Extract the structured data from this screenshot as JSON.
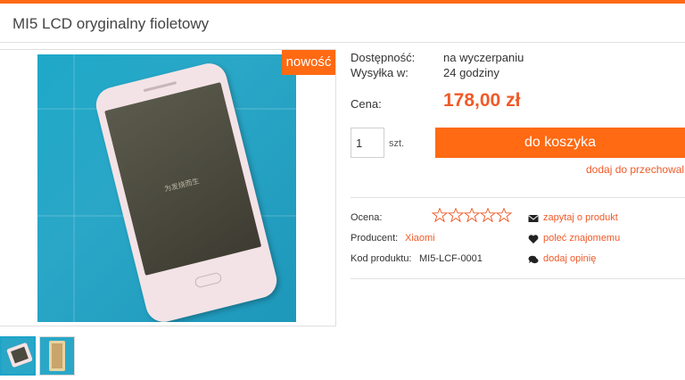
{
  "header": {
    "title": "MI5 LCD oryginalny fioletowy"
  },
  "gallery": {
    "badge": "nowość",
    "screen_text": "为发烧而生",
    "thumbnails": [
      "thumbnail-1",
      "thumbnail-2"
    ]
  },
  "availability": {
    "label": "Dostępność:",
    "value": "na wyczerpaniu"
  },
  "shipping": {
    "label": "Wysyłka w:",
    "value": "24 godziny"
  },
  "price": {
    "label": "Cena:",
    "value": "178,00 zł"
  },
  "cart": {
    "quantity": "1",
    "unit": "szt.",
    "button_label": "do koszyka",
    "store_link": "dodaj do przechowalni"
  },
  "details": {
    "rating_label": "Ocena:",
    "rating_stars": 0,
    "rating_max": 5,
    "producer_label": "Producent:",
    "producer_value": "Xiaomi",
    "code_label": "Kod produktu:",
    "code_value": "MI5-LCF-0001"
  },
  "actions": [
    {
      "label": "zapytaj o produkt",
      "icon": "envelope-icon"
    },
    {
      "label": "poleć znajomemu",
      "icon": "heart-icon"
    },
    {
      "label": "dodaj opinię",
      "icon": "comments-icon"
    }
  ],
  "colors": {
    "accent": "#ff6a13",
    "price": "#f05a28",
    "thumb_border": "#1ea3c8"
  }
}
